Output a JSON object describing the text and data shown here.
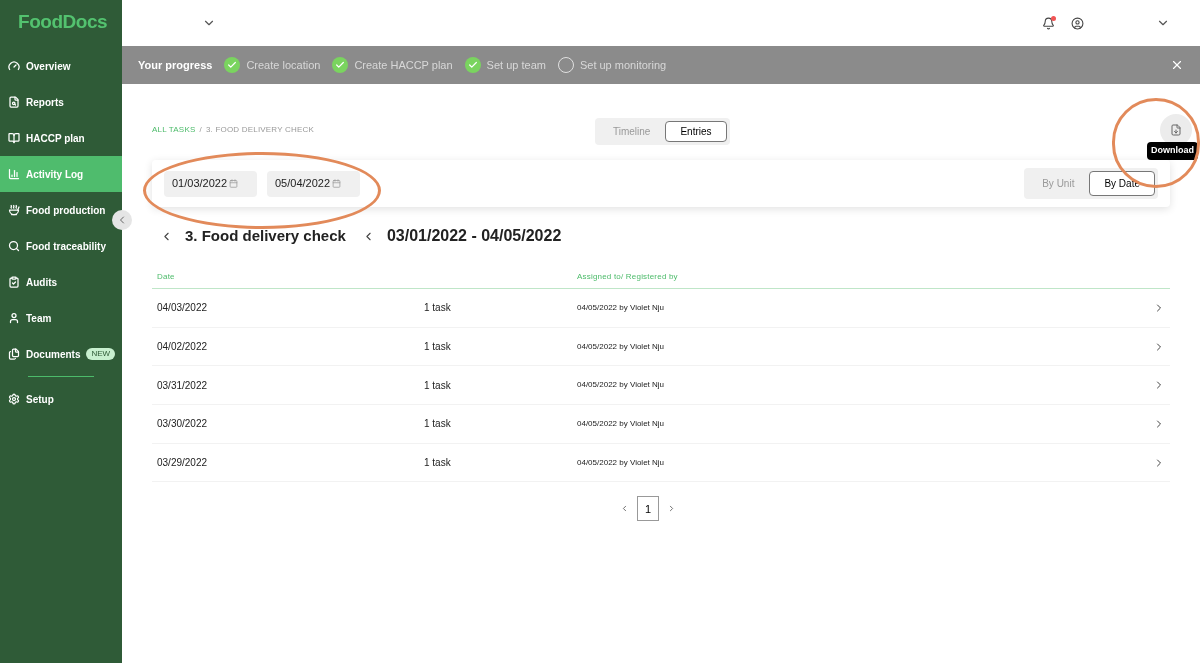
{
  "logo": {
    "text": "FoodDocs"
  },
  "sidebar": {
    "items": [
      {
        "label": "Overview",
        "kind": "gauge",
        "selected": false
      },
      {
        "label": "Reports",
        "kind": "report",
        "selected": false
      },
      {
        "label": "HACCP plan",
        "kind": "book",
        "selected": false
      },
      {
        "label": "Activity Log",
        "kind": "bars",
        "selected": true
      },
      {
        "label": "Food production",
        "kind": "bowl",
        "selected": false
      },
      {
        "label": "Food traceability",
        "kind": "search",
        "selected": false
      },
      {
        "label": "Audits",
        "kind": "clipboard",
        "selected": false
      },
      {
        "label": "Team",
        "kind": "user",
        "selected": false
      },
      {
        "label": "Documents",
        "kind": "docs",
        "selected": false,
        "badge": "NEW"
      },
      {
        "label": "Setup",
        "kind": "gear",
        "selected": false,
        "divider_before": true
      }
    ]
  },
  "topbar": {
    "notification_unread": true
  },
  "progress": {
    "title": "Your progress",
    "steps": [
      {
        "label": "Create location",
        "done": true
      },
      {
        "label": "Create HACCP plan",
        "done": true
      },
      {
        "label": "Set up team",
        "done": true
      },
      {
        "label": "Set up monitoring",
        "done": false
      }
    ]
  },
  "breadcrumb": {
    "link": "ALL TASKS",
    "separator": "/",
    "current": "3. FOOD DELIVERY CHECK"
  },
  "view_tabs": [
    {
      "label": "Timeline",
      "selected": false
    },
    {
      "label": "Entries",
      "selected": true
    }
  ],
  "download": {
    "tooltip": "Download"
  },
  "filters": {
    "date_from": "01/03/2022",
    "date_to": "05/04/2022",
    "group_tabs": [
      {
        "label": "By Unit",
        "selected": false
      },
      {
        "label": "By Date",
        "selected": true
      }
    ]
  },
  "heading": {
    "title": "3. Food delivery check",
    "range": "03/01/2022 - 04/05/2022"
  },
  "table": {
    "columns": [
      "Date",
      "Assigned to/ Registered by"
    ],
    "rows": [
      {
        "date": "04/03/2022",
        "tasks": "1 task",
        "registered": "04/05/2022 by Violet Nju"
      },
      {
        "date": "04/02/2022",
        "tasks": "1 task",
        "registered": "04/05/2022 by Violet Nju"
      },
      {
        "date": "03/31/2022",
        "tasks": "1 task",
        "registered": "04/05/2022 by Violet Nju"
      },
      {
        "date": "03/30/2022",
        "tasks": "1 task",
        "registered": "04/05/2022 by Violet Nju"
      },
      {
        "date": "03/29/2022",
        "tasks": "1 task",
        "registered": "04/05/2022 by Violet Nju"
      }
    ]
  },
  "pagination": {
    "pages": [
      {
        "label": "1",
        "selected": true
      }
    ]
  },
  "annotations": [
    {
      "kind": "ellipse"
    },
    {
      "kind": "circle"
    }
  ]
}
